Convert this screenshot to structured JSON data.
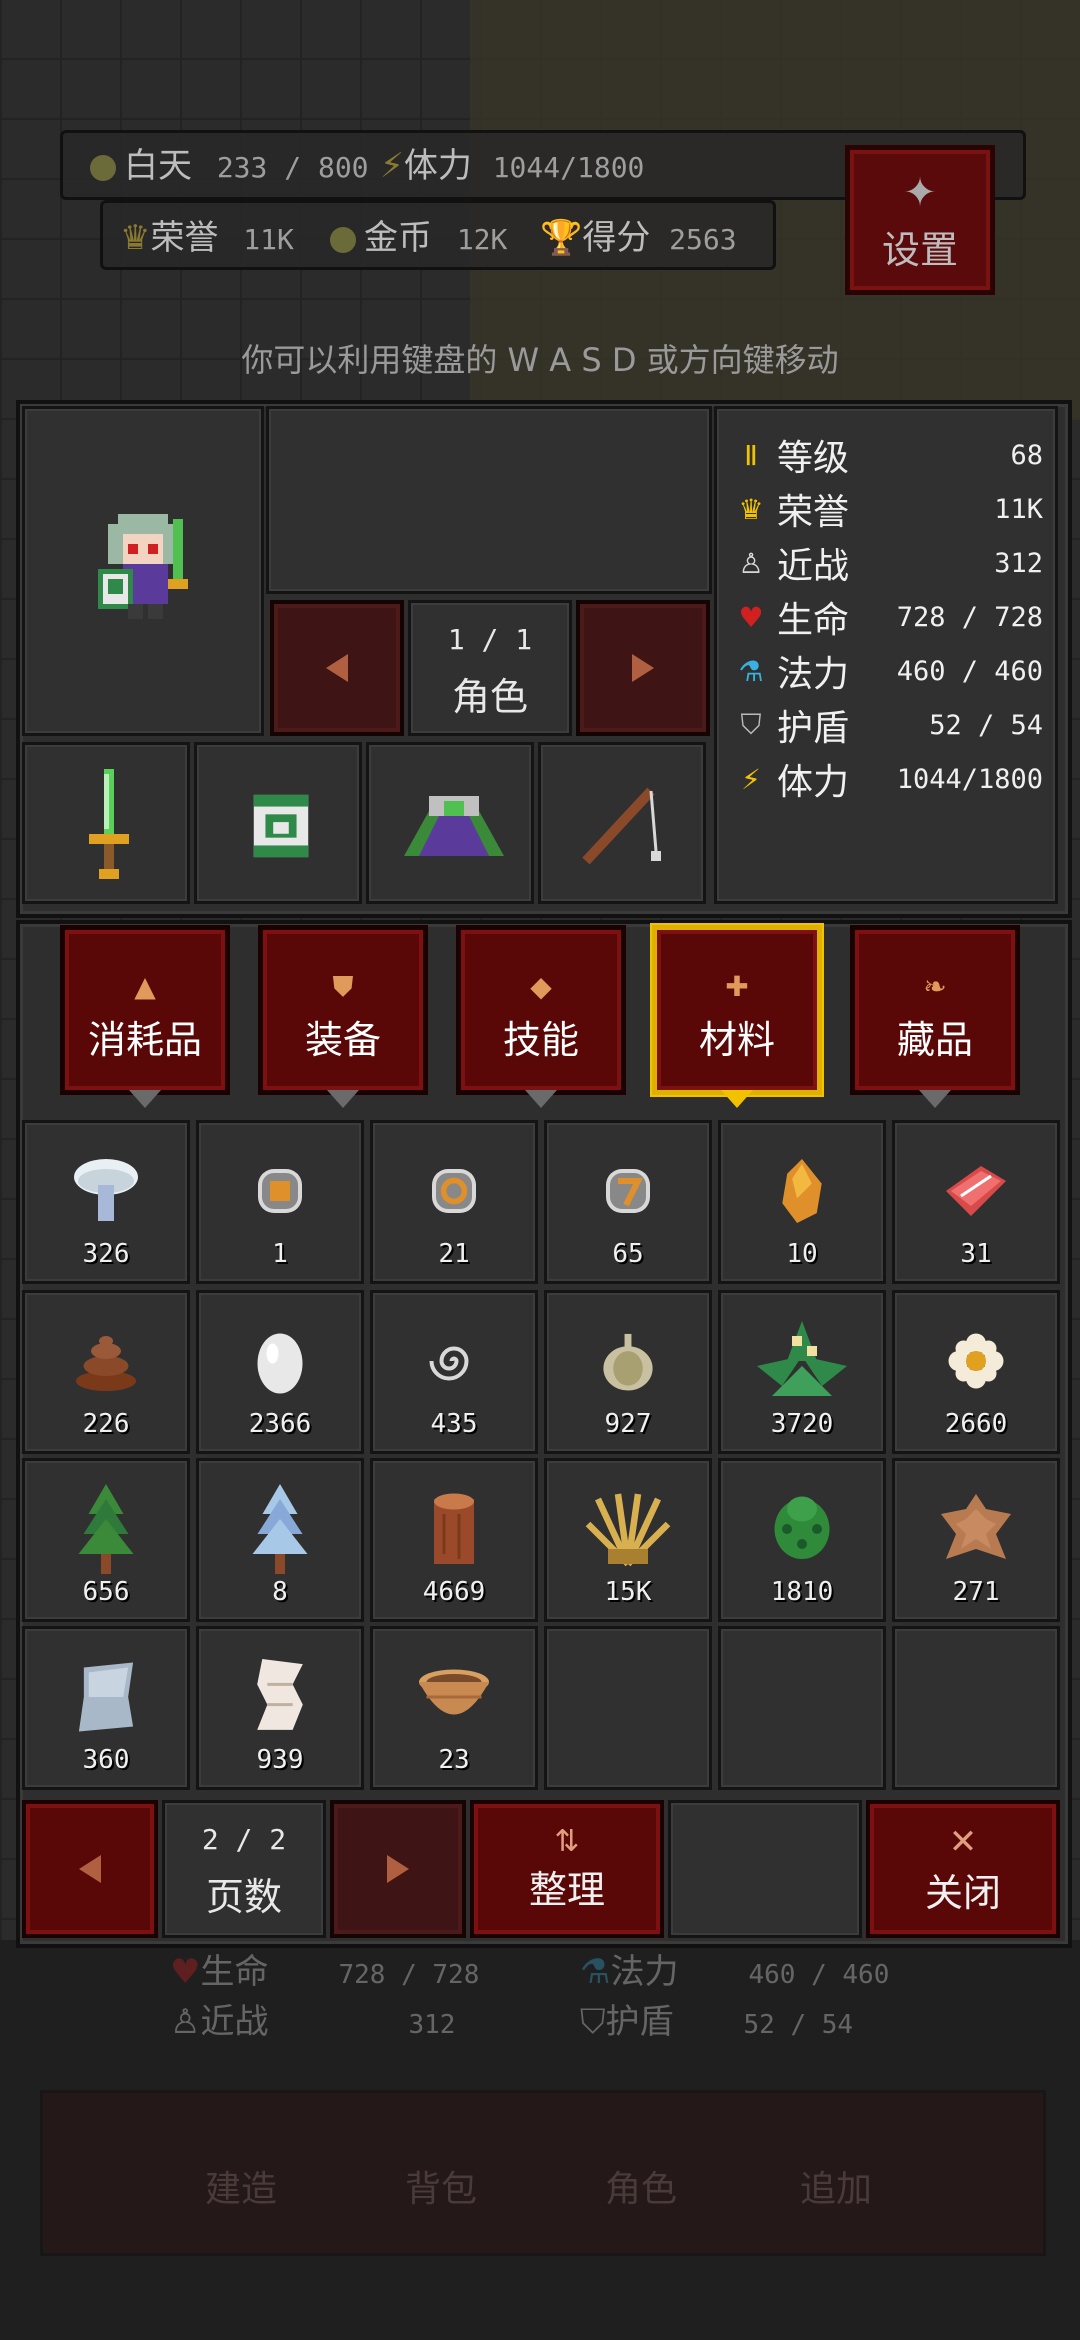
{
  "hud": {
    "day_label": "白天",
    "day_value": "233 / 800",
    "stamina_label": "体力",
    "stamina_value": "1044/1800",
    "honor_label": "荣誉",
    "honor_value": "11K",
    "gold_label": "金币",
    "gold_value": "12K",
    "score_label": "得分",
    "score_value": "2563",
    "settings_label": "设置",
    "hint": "你可以利用键盘的 W A S D 或方向键移动"
  },
  "character": {
    "page": "1 / 1",
    "page_label": "角色",
    "equipment": [
      "sword-icon",
      "armor-can-icon",
      "cloak-icon",
      "fishing-rod-icon"
    ]
  },
  "stats": [
    {
      "icon": "level-icon",
      "label": "等级",
      "value": "68",
      "color": "#f2c200"
    },
    {
      "icon": "crown-icon",
      "label": "荣誉",
      "value": "11K",
      "color": "#f2c200"
    },
    {
      "icon": "melee-icon",
      "label": "近战",
      "value": "312",
      "color": "#d8d8d8"
    },
    {
      "icon": "heart-icon",
      "label": "生命",
      "value": "728 / 728",
      "color": "#d02020"
    },
    {
      "icon": "mana-icon",
      "label": "法力",
      "value": "460 / 460",
      "color": "#3ab0e0"
    },
    {
      "icon": "shield-icon",
      "label": "护盾",
      "value": "52 / 54",
      "color": "#bbbbbb"
    },
    {
      "icon": "stamina-icon",
      "label": "体力",
      "value": "1044/1800",
      "color": "#f2c200"
    }
  ],
  "tabs": [
    {
      "label": "消耗品",
      "icon": "potion-icon",
      "active": false
    },
    {
      "label": "装备",
      "icon": "shield-tab-icon",
      "active": false
    },
    {
      "label": "技能",
      "icon": "diamond-icon",
      "active": false
    },
    {
      "label": "材料",
      "icon": "cross-icon",
      "active": true
    },
    {
      "label": "藏品",
      "icon": "leaf-icon",
      "active": false
    }
  ],
  "inventory": [
    {
      "icon": "mushroom-icon",
      "count": "326"
    },
    {
      "icon": "orange-gem-coin-icon",
      "count": "1"
    },
    {
      "icon": "orange-swirl-coin-icon",
      "count": "21"
    },
    {
      "icon": "orange-seven-coin-icon",
      "count": "65"
    },
    {
      "icon": "amber-icon",
      "count": "10"
    },
    {
      "icon": "raw-meat-icon",
      "count": "31"
    },
    {
      "icon": "dung-icon",
      "count": "226"
    },
    {
      "icon": "egg-icon",
      "count": "2366"
    },
    {
      "icon": "spiral-icon",
      "count": "435"
    },
    {
      "icon": "garlic-icon",
      "count": "927"
    },
    {
      "icon": "herb-plant-icon",
      "count": "3720"
    },
    {
      "icon": "flower-icon",
      "count": "2660"
    },
    {
      "icon": "pine-tree-icon",
      "count": "656"
    },
    {
      "icon": "snow-tree-icon",
      "count": "8"
    },
    {
      "icon": "log-icon",
      "count": "4669"
    },
    {
      "icon": "wheat-icon",
      "count": "15K"
    },
    {
      "icon": "cactus-icon",
      "count": "1810"
    },
    {
      "icon": "leather-icon",
      "count": "271"
    },
    {
      "icon": "cloth-icon",
      "count": "360"
    },
    {
      "icon": "scroll-icon",
      "count": "939"
    },
    {
      "icon": "basket-icon",
      "count": "23"
    },
    {
      "icon": "",
      "count": ""
    },
    {
      "icon": "",
      "count": ""
    },
    {
      "icon": "",
      "count": ""
    }
  ],
  "footer": {
    "page": "2 / 2",
    "page_label": "页数",
    "sort_label": "整理",
    "close_label": "关闭"
  },
  "background_panel": {
    "hp_label": "生命",
    "hp_value": "728 / 728",
    "mp_label": "法力",
    "mp_value": "460 / 460",
    "melee_label": "近战",
    "melee_value": "312",
    "shield_label": "护盾",
    "shield_value": "52 / 54",
    "nav": [
      "建造",
      "背包",
      "角色",
      "追加"
    ]
  }
}
